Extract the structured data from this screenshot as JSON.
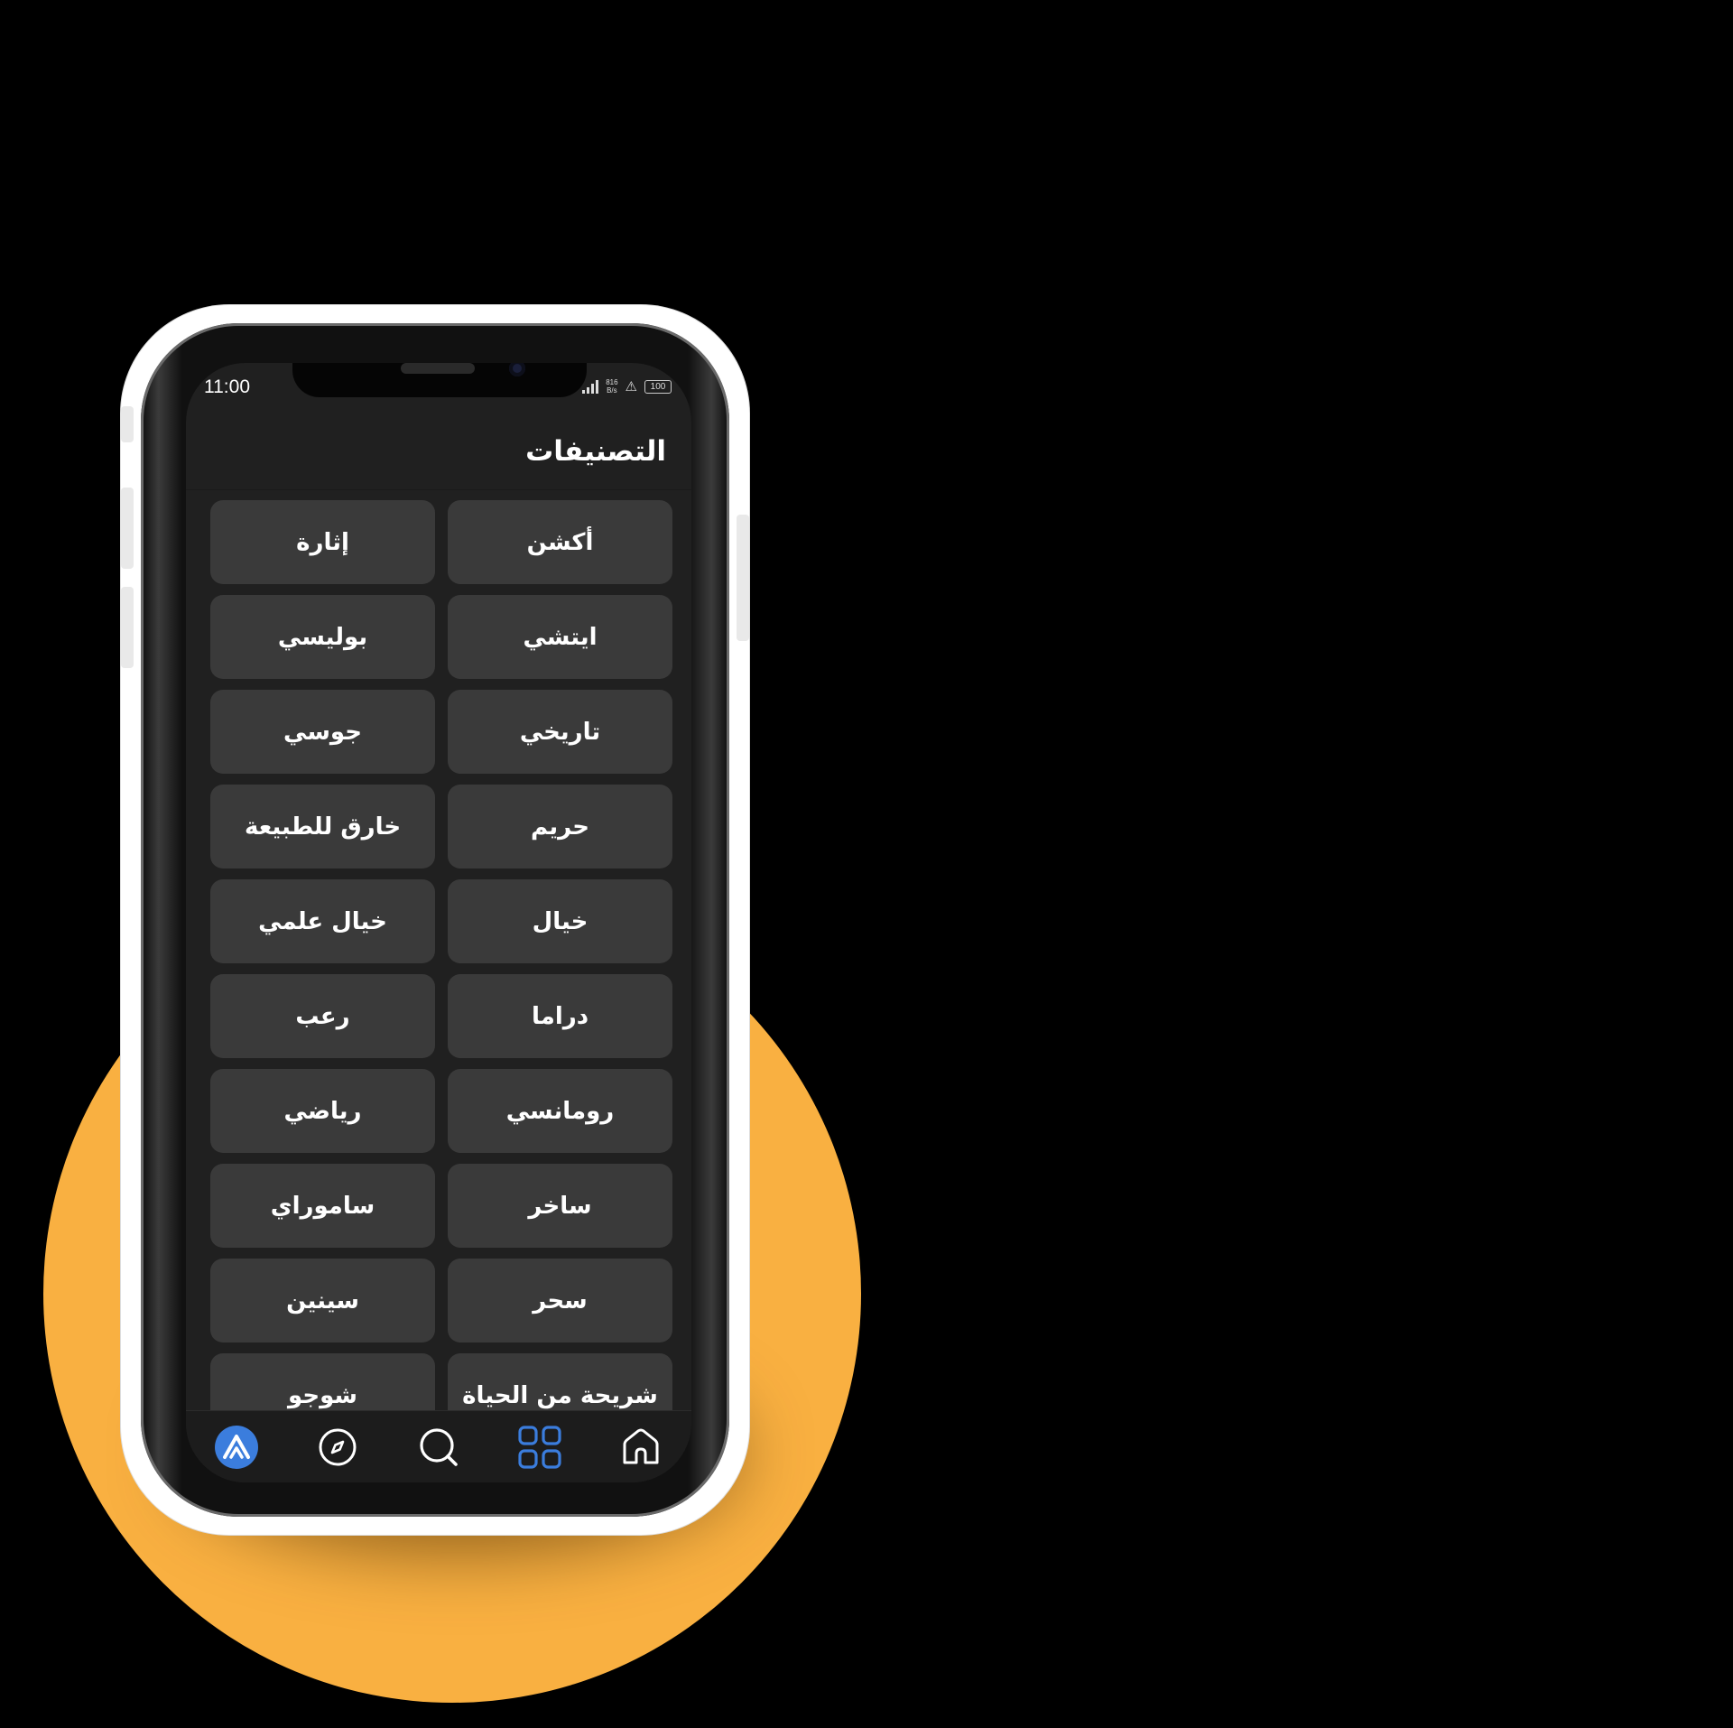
{
  "status_bar": {
    "time": "11:00",
    "net_speed_value": "816",
    "net_speed_unit": "B/s",
    "battery": "100"
  },
  "header": {
    "title": "التصنيفات"
  },
  "categories": [
    "أكشن",
    "إثارة",
    "ايتشي",
    "بوليسي",
    "تاريخي",
    "جوسي",
    "حريم",
    "خارق للطبيعة",
    "خيال",
    "خيال علمي",
    "دراما",
    "رعب",
    "رومانسي",
    "رياضي",
    "ساخر",
    "ساموراي",
    "سحر",
    "سينين",
    "شريحة من الحياة",
    "شوجو"
  ],
  "bottom_nav": {
    "items": [
      {
        "icon": "app-logo-icon",
        "active": false
      },
      {
        "icon": "compass-icon",
        "active": false
      },
      {
        "icon": "search-icon",
        "active": false
      },
      {
        "icon": "grid-icon",
        "active": true
      },
      {
        "icon": "home-icon",
        "active": false
      }
    ]
  },
  "colors": {
    "background": "#000000",
    "accent_disc": "#f9b041",
    "screen_bg": "#202020",
    "button_bg": "#3a3a3a",
    "nav_active": "#3b7ddd",
    "nav_inactive": "#ffffff"
  }
}
